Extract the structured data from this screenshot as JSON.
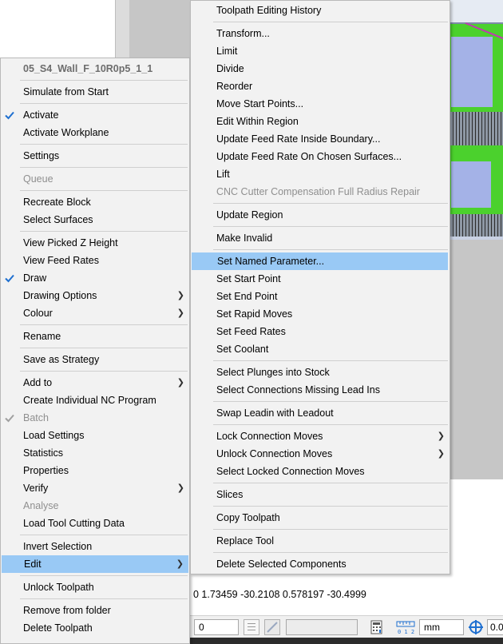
{
  "context_menu": {
    "title": "05_S4_Wall_F_10R0p5_1_1",
    "items": [
      {
        "label": "Simulate from Start"
      },
      {
        "label": "Activate"
      },
      {
        "label": "Activate Workplane"
      },
      {
        "label": "Settings"
      },
      {
        "label": "Queue"
      },
      {
        "label": "Recreate Block"
      },
      {
        "label": "Select Surfaces"
      },
      {
        "label": "View Picked Z Height"
      },
      {
        "label": "View Feed Rates"
      },
      {
        "label": "Draw"
      },
      {
        "label": "Drawing Options"
      },
      {
        "label": "Colour"
      },
      {
        "label": "Rename"
      },
      {
        "label": "Save as Strategy"
      },
      {
        "label": "Add to"
      },
      {
        "label": "Create Individual NC Program"
      },
      {
        "label": "Batch"
      },
      {
        "label": "Load Settings"
      },
      {
        "label": "Statistics"
      },
      {
        "label": "Properties"
      },
      {
        "label": "Verify"
      },
      {
        "label": "Analyse"
      },
      {
        "label": "Load Tool Cutting Data"
      },
      {
        "label": "Invert Selection"
      },
      {
        "label": "Edit"
      },
      {
        "label": "Unlock Toolpath"
      },
      {
        "label": "Remove from folder"
      },
      {
        "label": "Delete Toolpath"
      }
    ]
  },
  "edit_submenu": {
    "items": [
      {
        "label": "Toolpath Editing History"
      },
      {
        "label": "Transform..."
      },
      {
        "label": "Limit"
      },
      {
        "label": "Divide"
      },
      {
        "label": "Reorder"
      },
      {
        "label": "Move Start Points..."
      },
      {
        "label": "Edit Within Region"
      },
      {
        "label": "Update Feed Rate Inside Boundary..."
      },
      {
        "label": "Update Feed Rate On Chosen Surfaces..."
      },
      {
        "label": "Lift"
      },
      {
        "label": "CNC Cutter Compensation Full Radius Repair"
      },
      {
        "label": "Update Region"
      },
      {
        "label": "Make Invalid"
      },
      {
        "label": "Set Named Parameter..."
      },
      {
        "label": "Set Start Point"
      },
      {
        "label": "Set End Point"
      },
      {
        "label": "Set Rapid Moves"
      },
      {
        "label": "Set Feed Rates"
      },
      {
        "label": "Set Coolant"
      },
      {
        "label": "Select Plunges into Stock"
      },
      {
        "label": "Select Connections Missing Lead Ins"
      },
      {
        "label": "Swap Leadin with Leadout"
      },
      {
        "label": "Lock Connection Moves"
      },
      {
        "label": "Unlock Connection Moves"
      },
      {
        "label": "Select Locked Connection Moves"
      },
      {
        "label": "Slices"
      },
      {
        "label": "Copy Toolpath"
      },
      {
        "label": "Replace Tool"
      },
      {
        "label": "Delete Selected Components"
      }
    ]
  },
  "background": {
    "coordinates_text": "0 1.73459 -30.2108 0.578197 -30.4999"
  },
  "statusbar": {
    "value_field": "0",
    "units": "mm",
    "right_field": "0.0"
  },
  "colors": {
    "highlight": "#99c9f5",
    "check_mark": "#1e6fd0",
    "toolpath_green": "#4bd12d",
    "surface_blue": "#a4b2e7"
  }
}
